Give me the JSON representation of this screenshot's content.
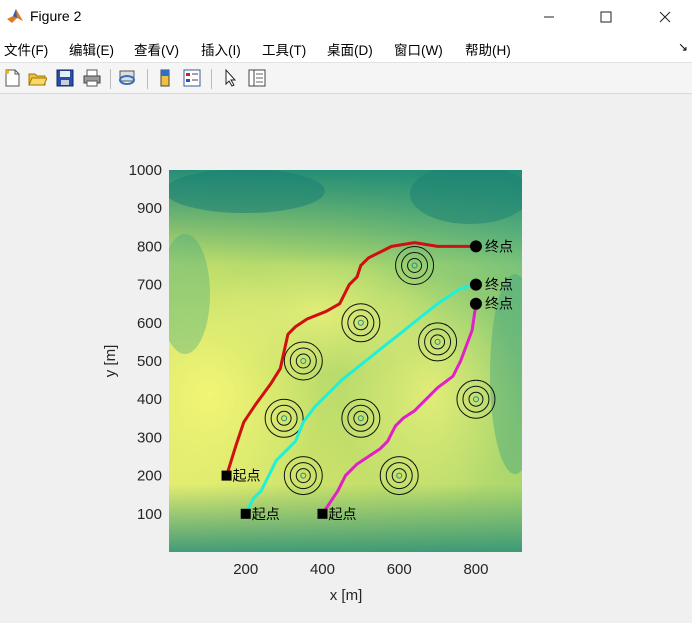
{
  "window": {
    "title": "Figure 2"
  },
  "menu": {
    "items": [
      "文件(F)",
      "编辑(E)",
      "查看(V)",
      "插入(I)",
      "工具(T)",
      "桌面(D)",
      "窗口(W)",
      "帮助(H)"
    ]
  },
  "toolbar": {
    "icons": [
      "new-figure-icon",
      "open-file-icon",
      "save-icon",
      "print-icon",
      "link-icon",
      "colorbar-icon",
      "legend-icon",
      "pointer-icon",
      "property-inspector-icon"
    ]
  },
  "chart_data": {
    "type": "line",
    "xlabel": "x [m]",
    "ylabel": "y [m]",
    "xlim": [
      0,
      920
    ],
    "ylim": [
      0,
      1000
    ],
    "xticks": [
      200,
      400,
      600,
      800
    ],
    "yticks": [
      100,
      200,
      300,
      400,
      500,
      600,
      700,
      800,
      900,
      1000
    ],
    "background": "terrain heatmap (green to yellow)",
    "series": [
      {
        "color": "#d01010",
        "points": [
          [
            150,
            200
          ],
          [
            175,
            280
          ],
          [
            195,
            340
          ],
          [
            225,
            385
          ],
          [
            265,
            440
          ],
          [
            290,
            480
          ],
          [
            310,
            570
          ],
          [
            330,
            590
          ],
          [
            360,
            610
          ],
          [
            410,
            630
          ],
          [
            445,
            650
          ],
          [
            470,
            700
          ],
          [
            490,
            720
          ],
          [
            500,
            750
          ],
          [
            520,
            770
          ],
          [
            580,
            800
          ],
          [
            640,
            810
          ],
          [
            700,
            800
          ],
          [
            800,
            800
          ]
        ]
      },
      {
        "color": "#20f0d8",
        "points": [
          [
            200,
            100
          ],
          [
            220,
            140
          ],
          [
            240,
            160
          ],
          [
            260,
            200
          ],
          [
            280,
            240
          ],
          [
            300,
            260
          ],
          [
            310,
            270
          ],
          [
            330,
            290
          ],
          [
            350,
            340
          ],
          [
            380,
            380
          ],
          [
            420,
            420
          ],
          [
            450,
            450
          ],
          [
            500,
            490
          ],
          [
            550,
            530
          ],
          [
            600,
            570
          ],
          [
            650,
            610
          ],
          [
            700,
            650
          ],
          [
            760,
            690
          ],
          [
            800,
            700
          ]
        ]
      },
      {
        "color": "#e020c8",
        "points": [
          [
            400,
            100
          ],
          [
            420,
            130
          ],
          [
            440,
            160
          ],
          [
            460,
            200
          ],
          [
            490,
            230
          ],
          [
            520,
            250
          ],
          [
            550,
            270
          ],
          [
            570,
            290
          ],
          [
            590,
            330
          ],
          [
            610,
            350
          ],
          [
            640,
            370
          ],
          [
            670,
            400
          ],
          [
            700,
            430
          ],
          [
            740,
            460
          ],
          [
            760,
            500
          ],
          [
            790,
            580
          ],
          [
            800,
            650
          ]
        ]
      }
    ],
    "start_label": "起点",
    "end_label": "终点",
    "starts": [
      [
        150,
        200
      ],
      [
        200,
        100
      ],
      [
        400,
        100
      ]
    ],
    "ends": [
      [
        800,
        800
      ],
      [
        800,
        700
      ],
      [
        800,
        650
      ]
    ],
    "obstacles": [
      [
        640,
        750
      ],
      [
        500,
        600
      ],
      [
        700,
        550
      ],
      [
        350,
        500
      ],
      [
        800,
        400
      ],
      [
        300,
        350
      ],
      [
        500,
        350
      ],
      [
        350,
        200
      ],
      [
        600,
        200
      ]
    ]
  }
}
